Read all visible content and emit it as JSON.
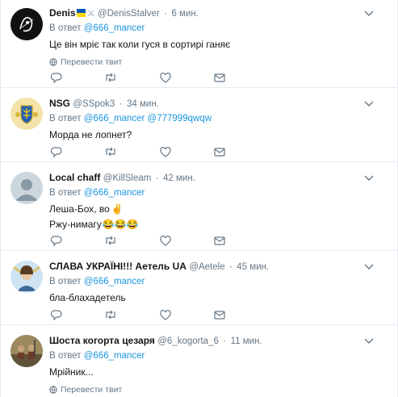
{
  "reply_prefix": "В ответ",
  "translate_label": "Перевести твит",
  "colors": {
    "accent": "#1b95e0",
    "muted": "#657786",
    "text": "#14171a",
    "border": "#e6ecf0"
  },
  "icons": [
    "reply-icon",
    "retweet-icon",
    "like-icon",
    "direct-message-icon",
    "chevron-down-icon",
    "globe-icon"
  ],
  "tweets": [
    {
      "name": "Denis",
      "name_decoration": "🇺🇦⚔️",
      "handle": "@DenisStalver",
      "time": "6 мин.",
      "reply_to": "@666_mancer",
      "lines": [
        "Це він мріє так коли гуся в сортирі ганяє"
      ],
      "show_translate": true
    },
    {
      "name": "NSG",
      "handle": "@SSpok3",
      "time": "34 мин.",
      "reply_to": "@666_mancer @777999qwqw",
      "lines": [
        "Морда не лопнет?"
      ],
      "show_translate": false
    },
    {
      "name": "Local chaff",
      "handle": "@KillSleam",
      "time": "42 мин.",
      "reply_to": "@666_mancer",
      "lines": [
        "Леша-Бох, во",
        "Ржу-нимагу"
      ],
      "line_emojis": [
        "✌",
        "😂😂😂"
      ],
      "show_translate": false
    },
    {
      "name": "СЛАВА УКРАЇНІ!!! Аетель UA",
      "handle": "@Aetele",
      "time": "45 мин.",
      "reply_to": "@666_mancer",
      "lines": [
        "бла-блахадетель"
      ],
      "show_translate": false
    },
    {
      "name": "Шоста когорта цезаря",
      "handle": "@6_kogorta_6",
      "time": "11 мин.",
      "reply_to": "@666_mancer",
      "lines": [
        "Мрійник..."
      ],
      "show_translate": true
    }
  ]
}
